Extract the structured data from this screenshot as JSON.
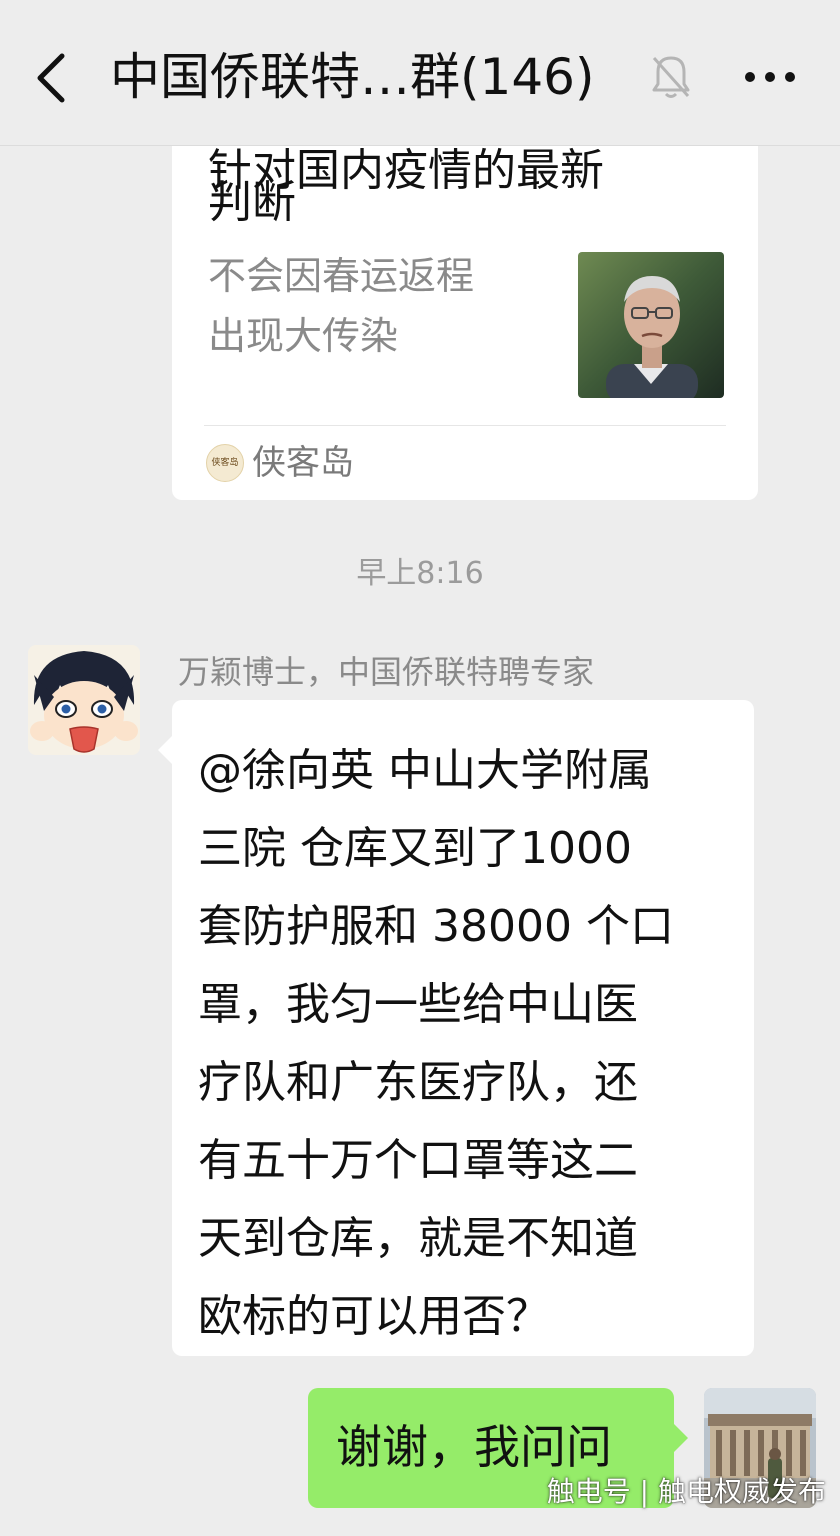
{
  "header": {
    "back_icon": "chevron-left-icon",
    "title": "中国侨联特…群(146)",
    "mute_icon": "bell-muted-icon",
    "more_icon": "more-dots-icon"
  },
  "article_card": {
    "title_clipped": "针对国内疫情的最新",
    "title_line": "判断",
    "description": [
      "不会因春运返程",
      "出现大传染"
    ],
    "source_logo_text": "侠客岛",
    "source_name": "侠客岛"
  },
  "timestamp": "早上8:16",
  "incoming_message": {
    "sender": "万颖博士，中国侨联特聘专家",
    "lines": [
      "@徐向英 中山大学附属",
      "三院  仓库又到了1000",
      "套防护服和 38000 个口",
      "罩，我匀一些给中山医",
      "疗队和广东医疗队，还",
      "有五十万个口罩等这二",
      "天到仓库，就是不知道",
      "欧标的可以用否？"
    ]
  },
  "outgoing_message": {
    "text": "谢谢，我问问"
  },
  "watermark": "触电号 | 触电权威发布",
  "colors": {
    "background": "#ededed",
    "outgoing_bubble": "#95ec69",
    "incoming_bubble": "#ffffff"
  }
}
